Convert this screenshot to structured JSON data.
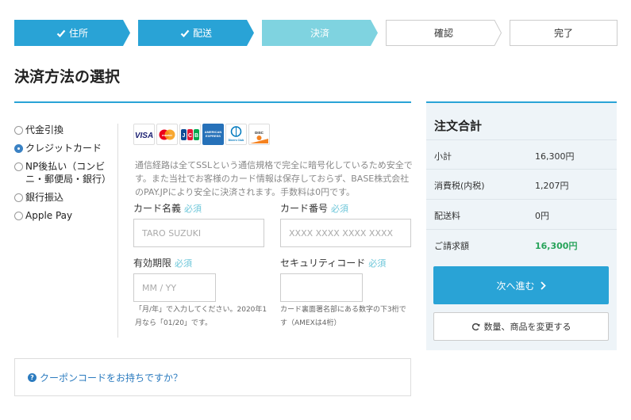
{
  "steps": [
    {
      "label": "住所",
      "state": "done"
    },
    {
      "label": "配送",
      "state": "done"
    },
    {
      "label": "決済",
      "state": "current"
    },
    {
      "label": "確認",
      "state": "todo"
    },
    {
      "label": "完了",
      "state": "todo"
    }
  ],
  "page_title": "決済方法の選択",
  "methods": [
    {
      "label": "代金引換",
      "checked": false
    },
    {
      "label": "クレジットカード",
      "checked": true
    },
    {
      "label": "NP後払い（コンビニ・郵便局・銀行）",
      "checked": false
    },
    {
      "label": "銀行振込",
      "checked": false
    },
    {
      "label": "Apple Pay",
      "checked": false
    }
  ],
  "card_brands": [
    {
      "name": "VISA"
    },
    {
      "name": "mastercard"
    },
    {
      "name": "JCB"
    },
    {
      "name": "AMERICAN EXPRESS"
    },
    {
      "name": "Diners Club INTERNATIONAL"
    },
    {
      "name": "DISCOVER"
    }
  ],
  "note": "通信経路は全てSSLという通信規格で完全に暗号化しているため安全です。また当社でお客様のカード情報は保存しておらず、BASE株式会社のPAY.JPにより安全に決済されます。手数料は0円です。",
  "form": {
    "required": "必須",
    "card_name": {
      "label": "カード名義",
      "placeholder": "TARO SUZUKI"
    },
    "card_number": {
      "label": "カード番号",
      "placeholder": "XXXX XXXX XXXX XXXX"
    },
    "expiry": {
      "label": "有効期限",
      "placeholder": "MM / YY",
      "hint": "「月/年」で入力してください。2020年1月なら「01/20」です。"
    },
    "cvc": {
      "label": "セキュリティコード",
      "placeholder": "",
      "hint": "カード裏面署名部にある数字の下3桁です（AMEXは4桁）"
    }
  },
  "coupon": {
    "label": "クーポンコードをお持ちですか？"
  },
  "summary": {
    "title": "注文合計",
    "rows": [
      {
        "key": "小計",
        "value": "16,300円"
      },
      {
        "key": "消費税(内税)",
        "value": "1,207円"
      },
      {
        "key": "配送料",
        "value": "0円"
      },
      {
        "key": "ご請求額",
        "value": "16,300円"
      }
    ],
    "next_label": "次へ進む",
    "change_label": "数量、商品を変更する"
  },
  "colors": {
    "accent": "#29a3d6",
    "current_step": "#7fd3e0",
    "required": "#6cc6d9",
    "total_green": "#27a35a",
    "link": "#2b7bbf"
  }
}
